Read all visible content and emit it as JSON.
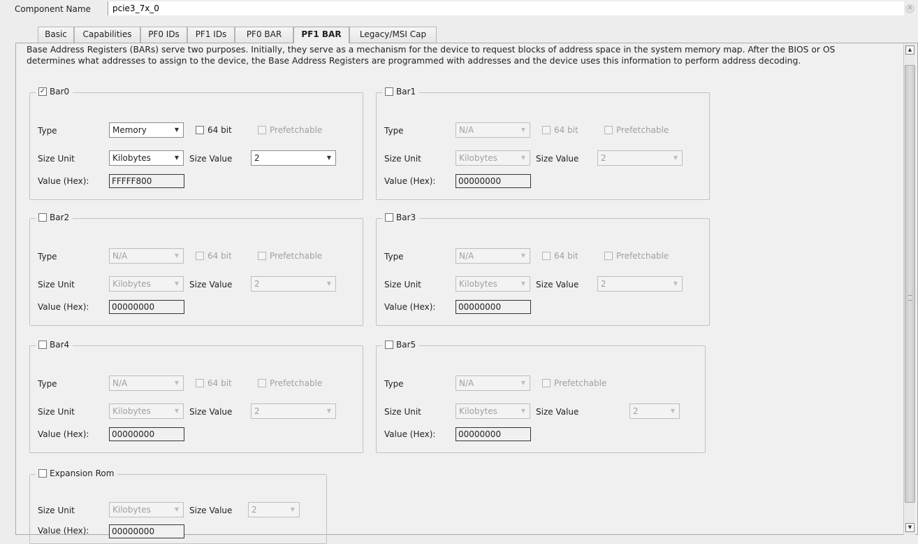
{
  "header": {
    "component_name_label": "Component Name",
    "component_name_value": "pcie3_7x_0"
  },
  "tabs": [
    {
      "label": "Basic"
    },
    {
      "label": "Capabilities"
    },
    {
      "label": "PF0 IDs"
    },
    {
      "label": "PF1 IDs"
    },
    {
      "label": "PF0 BAR"
    },
    {
      "label": "PF1 BAR",
      "active": true
    },
    {
      "label": "Legacy/MSI Cap"
    }
  ],
  "description": "Base Address Registers (BARs) serve two purposes. Initially, they serve as a mechanism for the device to request blocks of address space in the system memory map. After the BIOS or OS determines what addresses to assign to the device, the Base Address Registers are programmed with addresses and the device uses this information to perform address decoding.",
  "labels": {
    "type": "Type",
    "size_unit": "Size Unit",
    "size_value": "Size Value",
    "value_hex": "Value (Hex):",
    "bit64": "64 bit",
    "prefetchable": "Prefetchable"
  },
  "bars": {
    "bar0": {
      "label": "Bar0",
      "checked": true,
      "type": "Memory",
      "size_unit": "Kilobytes",
      "size_value": "2",
      "hex": "FFFFF800"
    },
    "bar1": {
      "label": "Bar1",
      "checked": false,
      "type": "N/A",
      "size_unit": "Kilobytes",
      "size_value": "2",
      "hex": "00000000"
    },
    "bar2": {
      "label": "Bar2",
      "checked": false,
      "type": "N/A",
      "size_unit": "Kilobytes",
      "size_value": "2",
      "hex": "00000000"
    },
    "bar3": {
      "label": "Bar3",
      "checked": false,
      "type": "N/A",
      "size_unit": "Kilobytes",
      "size_value": "2",
      "hex": "00000000"
    },
    "bar4": {
      "label": "Bar4",
      "checked": false,
      "type": "N/A",
      "size_unit": "Kilobytes",
      "size_value": "2",
      "hex": "00000000"
    },
    "bar5": {
      "label": "Bar5",
      "checked": false,
      "type": "N/A",
      "size_unit": "Kilobytes",
      "size_value": "2",
      "hex": "00000000"
    },
    "exprom": {
      "label": "Expansion Rom",
      "checked": false,
      "size_unit": "Kilobytes",
      "size_value": "2",
      "hex": "00000000"
    }
  },
  "icons": {
    "check": "✓",
    "dropdown": "▼",
    "scroll_up": "▲",
    "scroll_down": "▼",
    "clear": "✕"
  }
}
